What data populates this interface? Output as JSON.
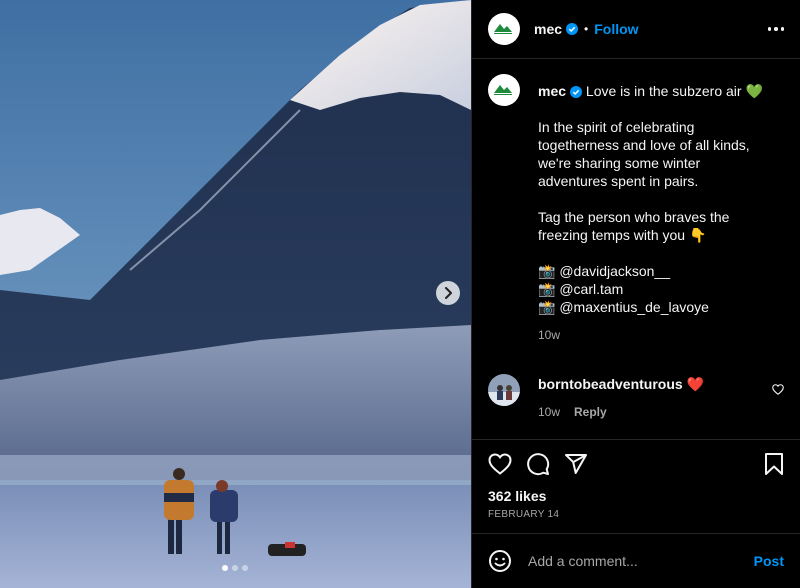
{
  "post": {
    "username": "mec",
    "follow_label": "Follow",
    "bullet": "•",
    "logo_text": "Mountain Equipment Company",
    "caption": {
      "line1": "Love is in the subzero air 💚",
      "para2": "In the spirit of celebrating togetherness and love of all kinds, we're sharing some winter adventures spent in pairs.",
      "para3": "Tag the person who braves the freezing temps with you 👇",
      "credits": [
        "📸 @davidjackson__",
        "📸 @carl.tam",
        "📸 @maxentius_de_lavoye"
      ],
      "time": "10w"
    },
    "comments": [
      {
        "username": "borntobeadventurous",
        "text": "❤️",
        "time": "10w",
        "reply_label": "Reply"
      }
    ],
    "likes": "362 likes",
    "date": "FEBRUARY 14",
    "add_comment_placeholder": "Add a comment...",
    "post_label": "Post"
  },
  "carousel": {
    "total": 3,
    "active_index": 1
  },
  "icons": {
    "next": "chevron-right-icon",
    "verified": "verified-badge-icon",
    "more": "more-horizontal-icon",
    "like": "heart-icon",
    "comment": "comment-icon",
    "share": "share-icon",
    "save": "bookmark-icon",
    "emoji": "emoji-icon"
  },
  "colors": {
    "accent": "#0095f6",
    "verified": "#0095f6",
    "background": "#000000",
    "secondary_text": "#a8a8a8"
  }
}
